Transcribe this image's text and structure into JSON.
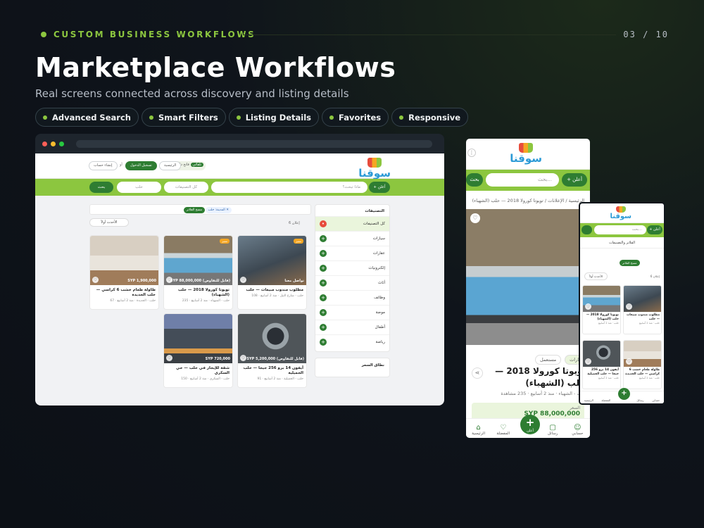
{
  "header": {
    "eyebrow": "CUSTOM BUSINESS WORKFLOWS",
    "pager": "03 / 10",
    "title": "Marketplace Workflows",
    "subtitle": "Real screens connected across discovery and listing details"
  },
  "chips": [
    "Advanced Search",
    "Smart Filters",
    "Listing Details",
    "Favorites",
    "Responsive"
  ],
  "desktop": {
    "logo": "سوقنا",
    "nav": {
      "create_account": "إنشاء حساب",
      "or": "أو",
      "login": "تسجيل الدخول",
      "home": "الرئيسية",
      "mode_dark": "داكن",
      "mode_light": "فاتح",
      "mode_auto": "تلقائي"
    },
    "search": {
      "post_ad": "+ أعلن",
      "placeholder": "ماذا تبحث؟",
      "category": "كل التصنيفات",
      "city": "حلب",
      "button": "بحث"
    },
    "sidebar": {
      "title": "التصنيفات",
      "items": [
        "كل التصنيفات",
        "سيارات",
        "عقارات",
        "إلكترونيات",
        "أثاث",
        "وظائف",
        "موضة",
        "أطفال",
        "رياضة",
        "خدمات",
        "أخرى"
      ]
    },
    "price_range_title": "نطاق السعر",
    "results": {
      "filter_tag": "المدينة: حلب ✕",
      "clear": "مسح الفلاتر",
      "count": "6 إعلان",
      "sort": "الأحدث أولاً"
    },
    "cards": [
      {
        "title": "مطلوب مندوب مبيعات — حلب",
        "badge": "مميز",
        "price": "تواصل معنا",
        "meta": "حلب - شارع النيل · منذ 2 أسابيع · 108"
      },
      {
        "title": "تويوتا كورولا 2018 — حلب (الشهباء)",
        "badge": "مميز",
        "price": "SYP 88,000,000 (قابل للتفاوض)",
        "meta": "حلب - الشهباء · منذ 2 أسابيع · 235"
      },
      {
        "title": "طاولة طعام خشب 6 كراسي — حلب الجديدة",
        "badge": "",
        "price": "SYP 1,900,000",
        "meta": "حلب - الجديدة · منذ 2 أسابيع · 67"
      },
      {
        "title": "آيفون 14 برو 256 جيجا — حلب الجميلية",
        "badge": "",
        "price": "SYP 5,200,000 (قابل للتفاوض)",
        "meta": "حلب - الجميلية · منذ 2 أسابيع · 91"
      },
      {
        "title": "شقة للإيجار في حلب — حي السكري",
        "badge": "",
        "price": "SYP 720,000",
        "meta": "حلب - السكري · منذ 2 أسابيع · 150"
      }
    ]
  },
  "phone1": {
    "search_placeholder": "بحث...",
    "search_button": "بحث",
    "post_ad": "+ أعلن",
    "breadcrumb": "الرئيسية / الإعلانات / تويوتا كورولا 2018 — حلب (الشهباء)",
    "tags": [
      "مستعمل",
      "سيارات"
    ],
    "title": "تويوتا كورولا 2018 — حلب (الشهباء)",
    "meta": "حلب - الشهباء · منذ 2 أسابيع · 235 مشاهدة",
    "price_label": "السعر",
    "price_value": "SYP 88,000,000",
    "nav": {
      "home": "الرئيسية",
      "favorites": "المفضلة",
      "post": "أعلن",
      "messages": "رسائل",
      "account": "حسابي"
    }
  },
  "phone2": {
    "search_placeholder": "بحث...",
    "post_ad": "+ أعلن",
    "filters_label": "الفلاتر والتصنيفات",
    "clear": "مسح الفلاتر",
    "sort": "الأحدث أولاً",
    "count": "6 إعلان",
    "cards": [
      {
        "title": "مطلوب مندوب مبيعات — حلب",
        "meta": "حلب · منذ 2 أسابيع"
      },
      {
        "title": "تويوتا كورولا 2018 — حلب (الشهباء)",
        "meta": "حلب · منذ 2 أسابيع"
      },
      {
        "title": "طاولة طعام خشب 6 كراسي — حلب الجديدة",
        "meta": "حلب · منذ 2 أسابيع"
      },
      {
        "title": "آيفون 14 برو 256 جيجا — حلب الجميلية",
        "meta": "حلب · منذ 2 أسابيع"
      }
    ],
    "nav": {
      "home": "الرئيسية",
      "favorites": "المفضلة",
      "post": "أعلن",
      "messages": "رسائل",
      "account": "حسابي"
    }
  }
}
